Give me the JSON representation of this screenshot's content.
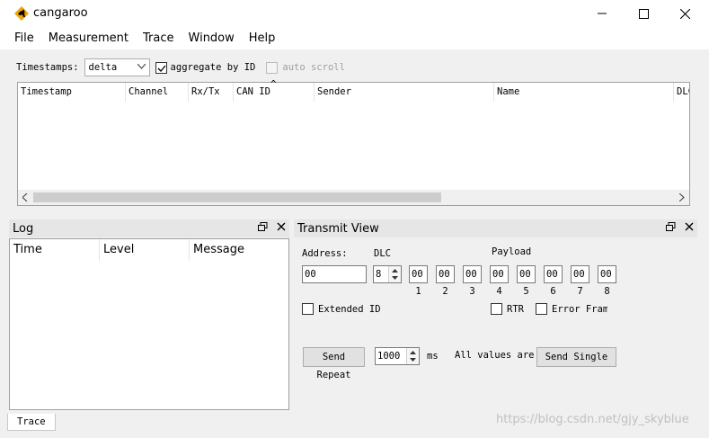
{
  "window": {
    "title": "cangaroo",
    "controls": {
      "minimize": "minimize-icon",
      "maximize": "maximize-icon",
      "close": "close-icon"
    }
  },
  "menu": [
    "File",
    "Measurement",
    "Trace",
    "Window",
    "Help"
  ],
  "trace": {
    "timestamps_label": "Timestamps:",
    "timestamps_value": "delta",
    "aggregate_label": "aggregate by ID",
    "aggregate_checked": true,
    "autoscroll_label": "auto scroll",
    "autoscroll_checked": false,
    "columns": [
      "Timestamp",
      "Channel",
      "Rx/Tx",
      "CAN ID",
      "Sender",
      "Name",
      "DLC"
    ],
    "sort_indicator": "^"
  },
  "log": {
    "title": "Log",
    "columns": [
      "Time",
      "Level",
      "Message"
    ]
  },
  "transmit": {
    "title": "Transmit View",
    "address_label": "Address:",
    "address_value": "00",
    "dlc_label": "DLC",
    "dlc_value": "8",
    "payload_label": "Payload",
    "bytes": [
      "00",
      "00",
      "00",
      "00",
      "00",
      "00",
      "00",
      "00"
    ],
    "byte_numbers": [
      "1",
      "2",
      "3",
      "4",
      "5",
      "6",
      "7",
      "8"
    ],
    "extended_id_label": "Extended ID",
    "rtr_label": "RTR",
    "error_frame_label": "Error Fram",
    "send_repeat_label": "Send Repeat",
    "repeat_value": "1000",
    "ms_label": "ms",
    "all_values_label": "All values are i",
    "send_single_label": "Send Single"
  },
  "tabs": [
    "Trace"
  ],
  "watermark": "https://blog.csdn.net/gjy_skyblue",
  "colors": {
    "panel_bg": "#f0f0f0",
    "titlebar_bg": "#ffffff",
    "dock_title_bg": "#e6e6e6",
    "icon_orange": "#f0a500"
  }
}
